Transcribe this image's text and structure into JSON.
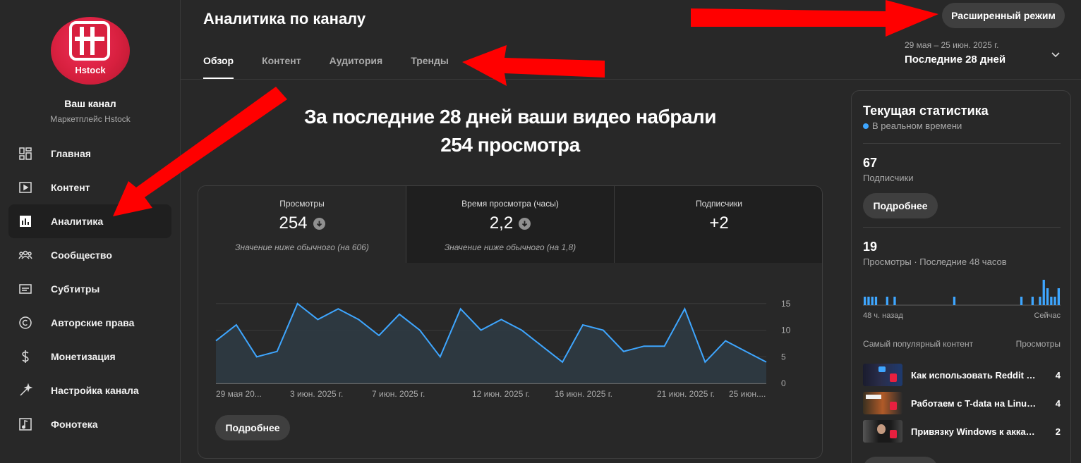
{
  "sidebar": {
    "logo_text": "Hstock",
    "channel_name": "Ваш канал",
    "channel_sub": "Маркетплейс Hstock",
    "items": [
      {
        "label": "Главная",
        "icon": "dashboard-icon"
      },
      {
        "label": "Контент",
        "icon": "content-icon"
      },
      {
        "label": "Аналитика",
        "icon": "analytics-icon",
        "active": true
      },
      {
        "label": "Сообщество",
        "icon": "community-icon"
      },
      {
        "label": "Субтитры",
        "icon": "subtitles-icon"
      },
      {
        "label": "Авторские права",
        "icon": "copyright-icon"
      },
      {
        "label": "Монетизация",
        "icon": "monetization-icon"
      },
      {
        "label": "Настройка канала",
        "icon": "customization-icon"
      },
      {
        "label": "Фонотека",
        "icon": "audio-library-icon"
      }
    ]
  },
  "header": {
    "title": "Аналитика по каналу",
    "tabs": [
      "Обзор",
      "Контент",
      "Аудитория",
      "Тренды"
    ],
    "advanced_button": "Расширенный режим",
    "date_range": "29 мая – 25 июн. 2025 г.",
    "period": "Последние 28 дней"
  },
  "main": {
    "headline_line1": "За последние 28 дней ваши видео набрали",
    "headline_line2": "254 просмотра",
    "metrics": [
      {
        "label": "Просмотры",
        "value": "254",
        "note": "Значение ниже обычного (на 606)"
      },
      {
        "label": "Время просмотра (часы)",
        "value": "2,2",
        "note": "Значение ниже обычного (на 1,8)"
      },
      {
        "label": "Подписчики",
        "value": "+2",
        "note": ""
      }
    ],
    "more_button": "Подробнее"
  },
  "chart_data": {
    "type": "area",
    "x": [
      "29 мая 20...",
      "3 июн. 2025 г.",
      "7 июн. 2025 г.",
      "12 июн. 2025 г.",
      "16 июн. 2025 г.",
      "21 июн. 2025 г.",
      "25 июн...."
    ],
    "values": [
      8,
      11,
      5,
      6,
      15,
      12,
      14,
      12,
      9,
      13,
      10,
      5,
      14,
      10,
      12,
      10,
      7,
      4,
      11,
      10,
      6,
      7,
      7,
      14,
      4,
      8,
      6,
      4
    ],
    "yticks": [
      0,
      5,
      10,
      15
    ],
    "ylim": [
      0,
      17
    ],
    "series_color": "#3ea6ff"
  },
  "realtime": {
    "title": "Текущая статистика",
    "live": "В реальном времени",
    "subs_value": "67",
    "subs_label": "Подписчики",
    "more_button": "Подробнее",
    "views_value": "19",
    "views_label": "Просмотры · Последние 48 часов",
    "bars": [
      1,
      1,
      1,
      1,
      0,
      0,
      1,
      0,
      1,
      0,
      0,
      0,
      0,
      0,
      0,
      0,
      0,
      0,
      0,
      0,
      0,
      0,
      0,
      0,
      1,
      0,
      0,
      0,
      0,
      0,
      0,
      0,
      0,
      0,
      0,
      0,
      0,
      0,
      0,
      0,
      0,
      0,
      1,
      0,
      0,
      1,
      0,
      1,
      3,
      2,
      1,
      1,
      2
    ],
    "axis_left": "48 ч. назад",
    "axis_right": "Сейчас",
    "top_content_label": "Самый популярный контент",
    "top_views_label": "Просмотры",
    "top_content": [
      {
        "title": "Как использовать Reddit дл...",
        "views": "4"
      },
      {
        "title": "Работаем с T-data на Linux! ...",
        "views": "4"
      },
      {
        "title": "Привязку Windows к аккаун...",
        "views": "2"
      }
    ]
  }
}
